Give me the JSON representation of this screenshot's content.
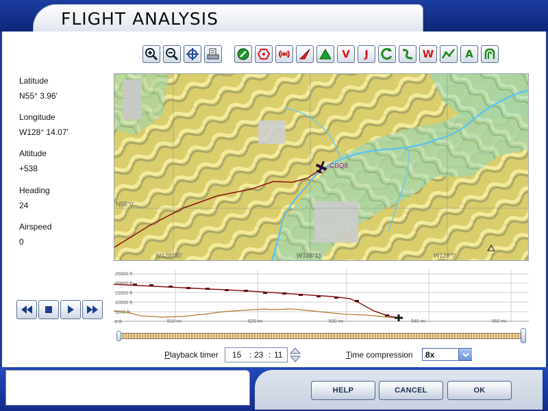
{
  "window": {
    "title": "FLIGHT ANALYSIS"
  },
  "toolbar": {
    "map_tools": [
      "zoom-in",
      "zoom-out",
      "center",
      "print"
    ],
    "layer_tools": [
      "airports",
      "vor",
      "ndb",
      "intersections",
      "terrain",
      "victor-airways",
      "jet-airways",
      "approach",
      "flight-path",
      "weather",
      "airways-network",
      "airspace",
      "procedures"
    ],
    "v_label": "V",
    "j_label": "J",
    "w_label": "W"
  },
  "info": {
    "latitude_label": "Latitude",
    "latitude": "N55° 3.96'",
    "longitude_label": "Longitude",
    "longitude": "W128° 14.07'",
    "altitude_label": "Altitude",
    "altitude": "+538",
    "heading_label": "Heading",
    "heading": "24",
    "airspeed_label": "Airspeed",
    "airspeed": "0"
  },
  "map": {
    "airport_id": "CBQ8",
    "grid_labels": [
      "W128°30'",
      "W128°15'",
      "W128°0'",
      "N55°0'"
    ]
  },
  "profile": {
    "y_labels": [
      "25000 ft",
      "20000 ft",
      "15000 ft",
      "10000 ft",
      "5000 ft",
      "0 ft"
    ],
    "x_labels": [
      "510 mi",
      "520 mi",
      "530 mi",
      "540 mi",
      "550 mi"
    ]
  },
  "playback": {
    "timer_label": "Playback timer",
    "hours": "15",
    "minutes": "23",
    "seconds": "11",
    "time_compression_label": "Time compression",
    "time_compression_value": "8x",
    "position": 1.0
  },
  "buttons": {
    "help": "HELP",
    "cancel": "CANCEL",
    "ok": "OK"
  },
  "colors": {
    "frame_blue": "#1b3da0",
    "path_red": "#8b1010",
    "terrain_brown": "#b07a2a"
  }
}
